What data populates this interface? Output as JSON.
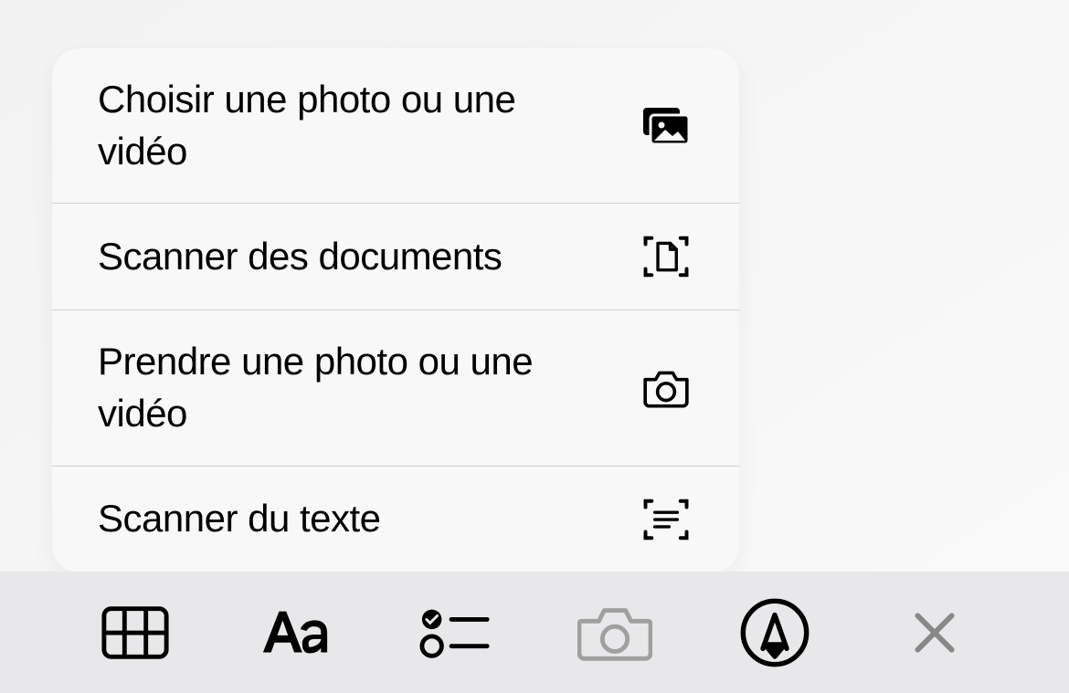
{
  "menu": {
    "items": [
      {
        "label": "Choisir une photo ou une vidéo",
        "icon": "photo-gallery-icon"
      },
      {
        "label": "Scanner des documents",
        "icon": "document-scan-icon"
      },
      {
        "label": "Prendre une photo ou une vidéo",
        "icon": "camera-icon"
      },
      {
        "label": "Scanner du texte",
        "icon": "text-scan-icon"
      }
    ]
  },
  "toolbar": {
    "items": [
      {
        "name": "table",
        "active": true
      },
      {
        "name": "text-format",
        "active": true
      },
      {
        "name": "checklist",
        "active": true
      },
      {
        "name": "camera",
        "active": false
      },
      {
        "name": "markup",
        "active": true
      },
      {
        "name": "close",
        "active": true
      }
    ]
  }
}
